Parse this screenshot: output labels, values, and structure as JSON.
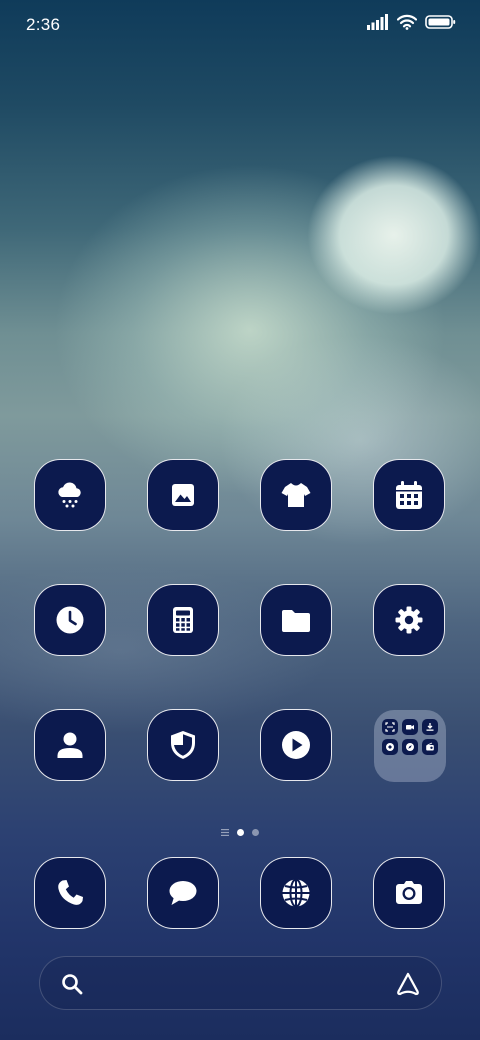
{
  "status_bar": {
    "time": "2:36",
    "icons": [
      "cellular-signal-icon",
      "wifi-icon",
      "battery-icon"
    ]
  },
  "home_grid": [
    {
      "icon": "weather-snow-icon",
      "row": 1,
      "col": 1
    },
    {
      "icon": "gallery-icon",
      "row": 1,
      "col": 2
    },
    {
      "icon": "themes-shirt-icon",
      "row": 1,
      "col": 3
    },
    {
      "icon": "calendar-icon",
      "row": 1,
      "col": 4
    },
    {
      "icon": "clock-icon",
      "row": 2,
      "col": 1
    },
    {
      "icon": "calculator-icon",
      "row": 2,
      "col": 2
    },
    {
      "icon": "file-manager-folder-icon",
      "row": 2,
      "col": 3
    },
    {
      "icon": "settings-gear-icon",
      "row": 2,
      "col": 4
    },
    {
      "icon": "contacts-person-icon",
      "row": 3,
      "col": 1
    },
    {
      "icon": "security-shield-icon",
      "row": 3,
      "col": 2
    },
    {
      "icon": "video-player-icon",
      "row": 3,
      "col": 3
    }
  ],
  "folder": {
    "icons": [
      "scanner-icon",
      "video-camera-icon",
      "download-icon",
      "apps-icon",
      "compass-icon",
      "radio-icon"
    ]
  },
  "page_indicator": {
    "pages": 2,
    "active_page": 1,
    "has_feed_indicator": true
  },
  "dock": [
    {
      "icon": "phone-icon"
    },
    {
      "icon": "messages-icon"
    },
    {
      "icon": "browser-globe-icon"
    },
    {
      "icon": "camera-icon"
    }
  ],
  "search_bar": {
    "left_icon": "search-icon",
    "right_icon": "assistant-icon"
  },
  "colors": {
    "icon_background": "#0c1a4e",
    "icon_border": "#ffffff",
    "glyph": "#ffffff"
  }
}
